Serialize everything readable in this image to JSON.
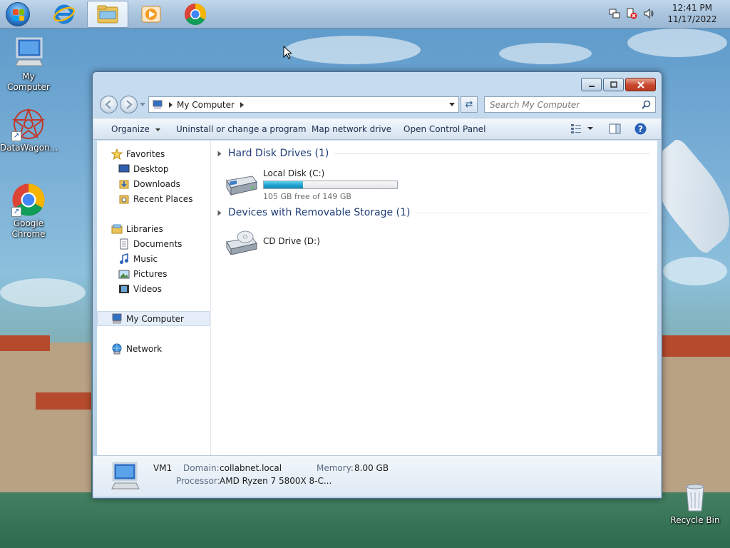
{
  "taskbar": {
    "pinned": [
      {
        "name": "internet-explorer",
        "icon": "ie-icon"
      },
      {
        "name": "windows-explorer",
        "icon": "folder-icon",
        "active": true
      },
      {
        "name": "media-player",
        "icon": "media-player-icon"
      },
      {
        "name": "google-chrome",
        "icon": "chrome-icon"
      }
    ],
    "clock": {
      "time": "12:41 PM",
      "date": "11/17/2022"
    }
  },
  "desktop": {
    "icons": [
      {
        "label": "My Computer",
        "icon": "computer-icon"
      },
      {
        "label": "DataWagon...",
        "icon": "datawagon-icon"
      },
      {
        "label": "Google Chrome",
        "icon": "chrome-icon"
      },
      {
        "label": "Recycle Bin",
        "icon": "recycle-bin-icon"
      }
    ]
  },
  "window": {
    "address": {
      "crumb": "My Computer"
    },
    "search": {
      "placeholder": "Search My Computer"
    },
    "commands": {
      "organize": "Organize",
      "uninstall": "Uninstall or change a program",
      "map_drive": "Map network drive",
      "control_panel": "Open Control Panel"
    },
    "nav": {
      "favorites": "Favorites",
      "desktop": "Desktop",
      "downloads": "Downloads",
      "recent": "Recent Places",
      "libraries": "Libraries",
      "documents": "Documents",
      "music": "Music",
      "pictures": "Pictures",
      "videos": "Videos",
      "computer": "My Computer",
      "network": "Network"
    },
    "groups": {
      "hdd": {
        "title": "Hard Disk Drives (1)",
        "drives": [
          {
            "name": "Local Disk (C:)",
            "free": "105 GB free of 149 GB",
            "used_fraction": 0.295
          }
        ]
      },
      "removable": {
        "title": "Devices with Removable Storage (1)",
        "drives": [
          {
            "name": "CD Drive (D:)"
          }
        ]
      }
    },
    "details": {
      "computer_name": "VM1",
      "domain_label": "Domain:",
      "domain_value": "collabnet.local",
      "memory_label": "Memory:",
      "memory_value": "8.00 GB",
      "processor_label": "Processor:",
      "processor_value": "AMD Ryzen 7 5800X 8-C..."
    }
  },
  "colors": {
    "accent": "#1e3c78",
    "progress": "#26a6d1",
    "close_button": "#c9462c"
  }
}
